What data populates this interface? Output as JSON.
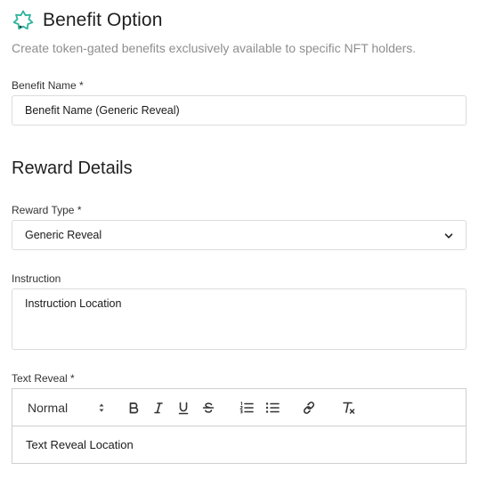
{
  "header": {
    "title": "Benefit Option",
    "subtitle": "Create token-gated benefits exclusively available to specific NFT holders.",
    "icon": "star-badge-icon",
    "accent_color": "#2fb39c"
  },
  "benefit_name": {
    "label": "Benefit Name *",
    "value": "Benefit Name (Generic Reveal)"
  },
  "reward_details": {
    "title": "Reward Details",
    "reward_type": {
      "label": "Reward Type *",
      "selected": "Generic Reveal"
    },
    "instruction": {
      "label": "Instruction",
      "value": "Instruction Location"
    },
    "text_reveal": {
      "label": "Text Reveal *",
      "toolbar": {
        "format_select": "Normal",
        "buttons": [
          "bold-icon",
          "italic-icon",
          "underline-icon",
          "strikethrough-icon",
          "ordered-list-icon",
          "bullet-list-icon",
          "link-icon",
          "clear-format-icon"
        ]
      },
      "content": "Text Reveal Location"
    }
  }
}
